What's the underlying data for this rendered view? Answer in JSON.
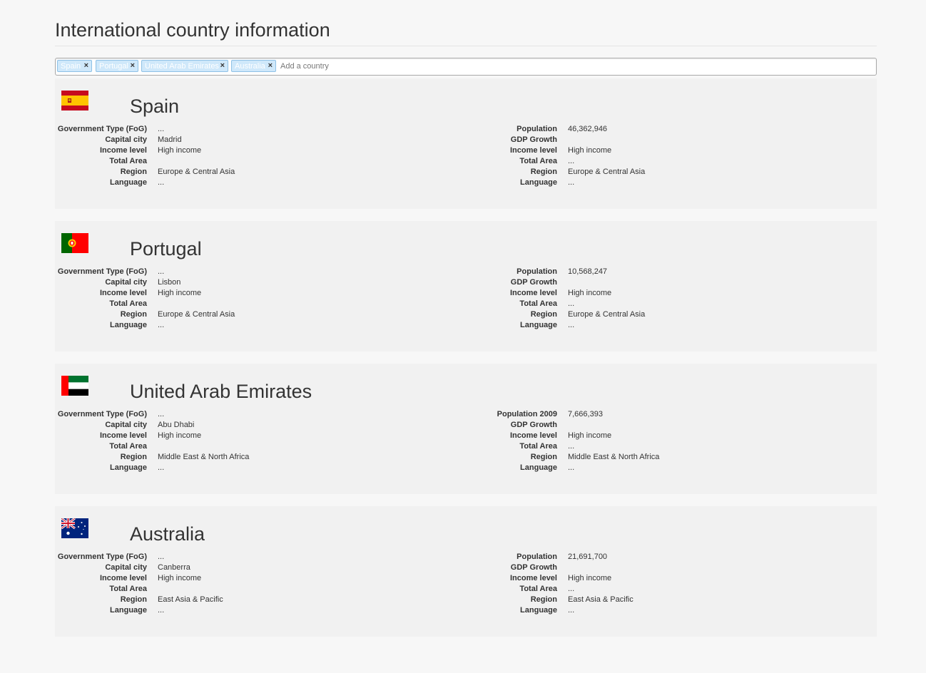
{
  "page": {
    "title": "International country information"
  },
  "search": {
    "placeholder": "Add a country",
    "tags": [
      {
        "label": "Spain",
        "remove": "×"
      },
      {
        "label": "Portugal",
        "remove": "×"
      },
      {
        "label": "United Arab Emirates",
        "remove": "×"
      },
      {
        "label": "Australia",
        "remove": "×"
      }
    ]
  },
  "labels": {
    "government_type": "Government Type (FoG)",
    "capital_city": "Capital city",
    "income_level": "Income level",
    "total_area": "Total Area",
    "region": "Region",
    "language": "Language",
    "gdp_growth": "GDP Growth"
  },
  "countries": [
    {
      "name": "Spain",
      "flag_icon": "spain-flag-icon",
      "left": {
        "government_type": "...",
        "capital_city": "Madrid",
        "income_level": "High income",
        "total_area": "",
        "region": "Europe & Central Asia",
        "language": "..."
      },
      "right": {
        "population_label": "Population",
        "population": "46,362,946",
        "gdp_growth": "",
        "income_level": "High income",
        "total_area": "...",
        "region": "Europe & Central Asia",
        "language": "..."
      }
    },
    {
      "name": "Portugal",
      "flag_icon": "portugal-flag-icon",
      "left": {
        "government_type": "...",
        "capital_city": "Lisbon",
        "income_level": "High income",
        "total_area": "",
        "region": "Europe & Central Asia",
        "language": "..."
      },
      "right": {
        "population_label": "Population",
        "population": "10,568,247",
        "gdp_growth": "",
        "income_level": "High income",
        "total_area": "...",
        "region": "Europe & Central Asia",
        "language": "..."
      }
    },
    {
      "name": "United Arab Emirates",
      "flag_icon": "uae-flag-icon",
      "left": {
        "government_type": "...",
        "capital_city": "Abu Dhabi",
        "income_level": "High income",
        "total_area": "",
        "region": "Middle East & North Africa",
        "language": "..."
      },
      "right": {
        "population_label": "Population 2009",
        "population": "7,666,393",
        "gdp_growth": "",
        "income_level": "High income",
        "total_area": "...",
        "region": "Middle East & North Africa",
        "language": "..."
      }
    },
    {
      "name": "Australia",
      "flag_icon": "australia-flag-icon",
      "left": {
        "government_type": "...",
        "capital_city": "Canberra",
        "income_level": "High income",
        "total_area": "",
        "region": "East Asia & Pacific",
        "language": "..."
      },
      "right": {
        "population_label": "Population",
        "population": "21,691,700",
        "gdp_growth": "",
        "income_level": "High income",
        "total_area": "...",
        "region": "East Asia & Pacific",
        "language": "..."
      }
    }
  ],
  "colors": {
    "background": "#f7f7f7",
    "card": "#f1f1f1",
    "tag_bg": "#cfe8fa",
    "tag_border": "#8ec1e6"
  }
}
